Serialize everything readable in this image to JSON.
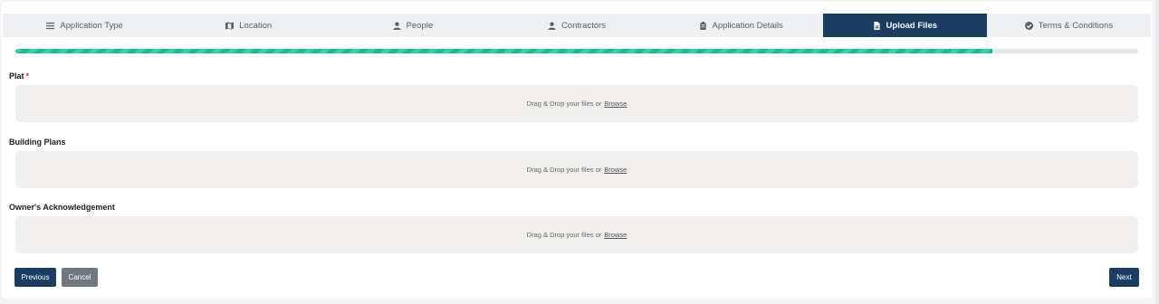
{
  "tabs": [
    {
      "label": "Application Type",
      "icon": "list-icon",
      "active": false
    },
    {
      "label": "Location",
      "icon": "map-icon",
      "active": false
    },
    {
      "label": "People",
      "icon": "person-icon",
      "active": false
    },
    {
      "label": "Contractors",
      "icon": "person-icon",
      "active": false
    },
    {
      "label": "Application Details",
      "icon": "clipboard-icon",
      "active": false
    },
    {
      "label": "Upload Files",
      "icon": "file-icon",
      "active": true
    },
    {
      "label": "Terms & Conditions",
      "icon": "check-circle-icon",
      "active": false
    }
  ],
  "progress": {
    "percent": 87
  },
  "uploads": [
    {
      "label": "Plat",
      "required": true,
      "required_mark": "*",
      "drop_text": "Drag & Drop your files or",
      "browse_label": "Browse"
    },
    {
      "label": "Building Plans",
      "required": false,
      "drop_text": "Drag & Drop your files or",
      "browse_label": "Browse"
    },
    {
      "label": "Owner's Acknowledgement",
      "required": false,
      "drop_text": "Drag & Drop your files or",
      "browse_label": "Browse"
    }
  ],
  "buttons": {
    "previous": "Previous",
    "cancel": "Cancel",
    "next": "Next"
  },
  "colors": {
    "primary": "#1b3d63",
    "progress": "#30d3a8",
    "cancel": "#6f7781",
    "required": "#d0342c"
  }
}
